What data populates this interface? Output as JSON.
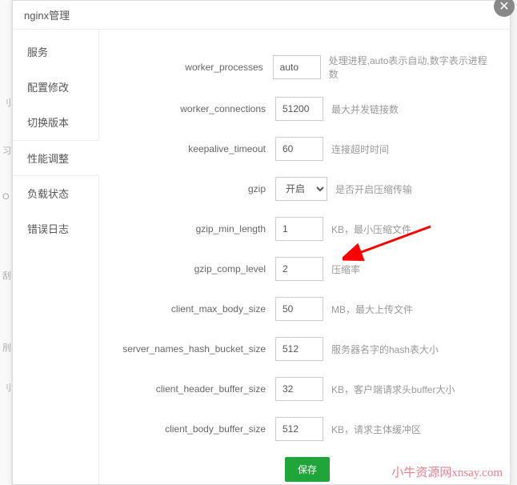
{
  "header": {
    "title": "nginx管理"
  },
  "sidebar": {
    "items": [
      {
        "label": "服务"
      },
      {
        "label": "配置修改"
      },
      {
        "label": "切换版本"
      },
      {
        "label": "性能调整"
      },
      {
        "label": "负载状态"
      },
      {
        "label": "错误日志"
      }
    ],
    "activeIndex": 3
  },
  "form": {
    "worker_processes": {
      "label": "worker_processes",
      "value": "auto",
      "hint": "处理进程,auto表示自动,数字表示进程数"
    },
    "worker_connections": {
      "label": "worker_connections",
      "value": "51200",
      "hint": "最大并发链接数"
    },
    "keepalive_timeout": {
      "label": "keepalive_timeout",
      "value": "60",
      "hint": "连接超时时间"
    },
    "gzip": {
      "label": "gzip",
      "value": "开启",
      "hint": "是否开启压缩传输"
    },
    "gzip_min_length": {
      "label": "gzip_min_length",
      "value": "1",
      "hint": "KB，最小压缩文件"
    },
    "gzip_comp_level": {
      "label": "gzip_comp_level",
      "value": "2",
      "hint": "压缩率"
    },
    "client_max_body_size": {
      "label": "client_max_body_size",
      "value": "50",
      "hint": "MB，最大上传文件"
    },
    "server_names_hash_bucket_size": {
      "label": "server_names_hash_bucket_size",
      "value": "512",
      "hint": "服务器名字的hash表大小"
    },
    "client_header_buffer_size": {
      "label": "client_header_buffer_size",
      "value": "32",
      "hint": "KB，客户端请求头buffer大小"
    },
    "client_body_buffer_size": {
      "label": "client_body_buffer_size",
      "value": "512",
      "hint": "KB，请求主体缓冲区"
    },
    "save_label": "保存"
  },
  "watermark": "小牛资源网xnsay.com",
  "left_edge": [
    "刂",
    "习",
    "O",
    "刮",
    "刖",
    "刂"
  ]
}
